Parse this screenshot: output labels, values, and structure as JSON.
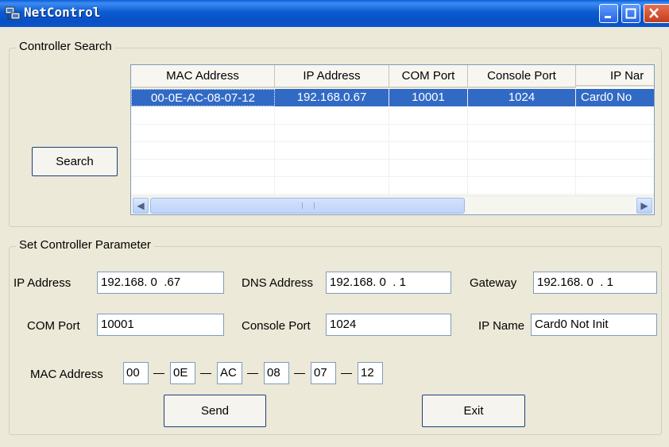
{
  "window": {
    "title": "NetControl"
  },
  "search_group": {
    "legend": "Controller Search",
    "search_button": "Search",
    "table": {
      "columns": [
        "MAC  Address",
        "IP  Address",
        "COM Port",
        "Console  Port",
        "IP  Nar"
      ],
      "rows": [
        {
          "mac": "00-0E-AC-08-07-12",
          "ip": "192.168.0.67",
          "com": "10001",
          "console": "1024",
          "ipname": "Card0 No"
        }
      ],
      "scroll_grip": "IIII"
    }
  },
  "param_group": {
    "legend": "Set Controller Parameter",
    "ip_label": "IP Address",
    "ip_value": "192.168. 0  .67",
    "dns_label": "DNS Address",
    "dns_value": "192.168. 0  . 1",
    "gateway_label": "Gateway",
    "gateway_value": "192.168. 0  . 1",
    "com_label": "COM Port",
    "com_value": "10001",
    "console_label": "Console Port",
    "console_value": "1024",
    "ipname_label": "IP Name",
    "ipname_value": "Card0 Not Init",
    "mac_label": "MAC Address",
    "mac_parts": [
      "00",
      "0E",
      "AC",
      "08",
      "07",
      "12"
    ],
    "send_button": "Send",
    "exit_button": "Exit"
  }
}
